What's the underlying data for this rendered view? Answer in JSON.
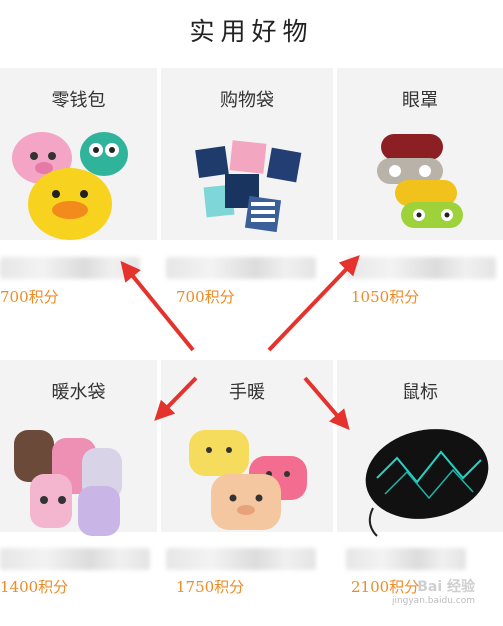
{
  "page": {
    "title": "实用好物"
  },
  "products": [
    {
      "name": "零钱包",
      "points": "700积分"
    },
    {
      "name": "购物袋",
      "points": "700积分"
    },
    {
      "name": "眼罩",
      "points": "1050积分"
    },
    {
      "name": "暖水袋",
      "points": "1400积分"
    },
    {
      "name": "手暖",
      "points": "1750积分"
    },
    {
      "name": "鼠标",
      "points": "2100积分"
    }
  ],
  "watermark": {
    "brand": "Bai 经验",
    "url": "jingyan.baidu.com"
  },
  "colors": {
    "points": "#f08a24",
    "arrow": "#e5322d",
    "card_bg": "#f3f3f3"
  }
}
